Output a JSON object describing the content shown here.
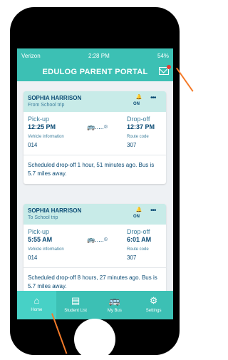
{
  "status": {
    "carrier": "Verizon",
    "time": "2:28 PM",
    "battery": "54%"
  },
  "app": {
    "title": "EDULOG PARENT PORTAL"
  },
  "cards": [
    {
      "name": "SOPHIA HARRISON",
      "trip": "From School trip",
      "bell": "ON",
      "pickup_label": "Pick-up",
      "pickup_time": "12:25 PM",
      "dropoff_label": "Drop-off",
      "dropoff_time": "12:37 PM",
      "vehicle_label": "Vehicle information",
      "vehicle": "014",
      "route_label": "Route code",
      "route": "307",
      "message": "Scheduled drop-off 1 hour, 51 minutes ago. Bus is 5.7 miles away."
    },
    {
      "name": "SOPHIA HARRISON",
      "trip": "To School trip",
      "bell": "ON",
      "pickup_label": "Pick-up",
      "pickup_time": "5:55 AM",
      "dropoff_label": "Drop-off",
      "dropoff_time": "6:01 AM",
      "vehicle_label": "Vehicle information",
      "vehicle": "014",
      "route_label": "Route code",
      "route": "307",
      "message": "Scheduled drop-off 8 hours, 27 minutes ago. Bus is 5.7 miles away."
    }
  ],
  "tabs": [
    {
      "label": "Home",
      "icon": "home-icon"
    },
    {
      "label": "Student List",
      "icon": "list-icon"
    },
    {
      "label": "My Bus",
      "icon": "bus-icon"
    },
    {
      "label": "Settings",
      "icon": "gear-icon"
    }
  ],
  "colors": {
    "accent": "#3cc0b4",
    "header": "#c8ebe8",
    "text": "#0b4b74",
    "arrow": "#f47b2a"
  }
}
